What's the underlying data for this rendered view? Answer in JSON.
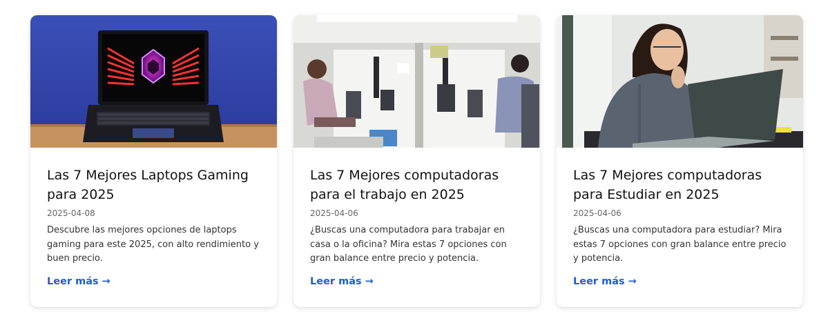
{
  "posts": [
    {
      "title": "Las 7 Mejores Laptops Gaming para 2025",
      "date": "2025-04-08",
      "excerpt": "Descubre las mejores opciones de laptops gaming para este 2025, con alto rendimiento y buen precio.",
      "link_label": "Leer más →",
      "image_icon": "gaming-laptop-photo"
    },
    {
      "title": "Las 7 Mejores computadoras para el trabajo en 2025",
      "date": "2025-04-06",
      "excerpt": "¿Buscas una computadora para trabajar en casa o la oficina? Mira estas 7 opciones con gran balance entre precio y potencia.",
      "link_label": "Leer más →",
      "image_icon": "office-workers-photo"
    },
    {
      "title": "Las 7 Mejores computadoras para Estudiar en 2025",
      "date": "2025-04-06",
      "excerpt": "¿Buscas una computadora para estudiar? Mira estas 7 opciones con gran balance entre precio y potencia.",
      "link_label": "Leer más →",
      "image_icon": "student-laptop-photo"
    }
  ],
  "colors": {
    "link": "#1a5fd0",
    "title": "#111111",
    "date": "#666666",
    "excerpt": "#333333"
  }
}
